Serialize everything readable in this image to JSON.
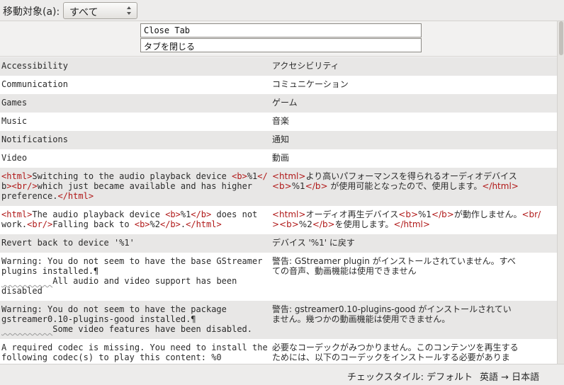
{
  "toolbar": {
    "move_target_label": "移動対象(a):",
    "move_target_value": "すべて"
  },
  "editor": {
    "source_text": "Close Tab",
    "translation_text": "タブを閉じる"
  },
  "rows": [
    {
      "src": "Accessibility",
      "tgt": "アクセシビリティ"
    },
    {
      "src": "Communication",
      "tgt": "コミュニケーション"
    },
    {
      "src": "Games",
      "tgt": "ゲーム"
    },
    {
      "src": "Music",
      "tgt": "音楽"
    },
    {
      "src": "Notifications",
      "tgt": "通知"
    },
    {
      "src": "Video",
      "tgt": "動画"
    },
    {
      "src": "<html>Switching to the audio playback device <b>%1</\nb><br/>which just became available and has higher\npreference.</html>",
      "tgt": "<html>より高いパフォーマンスを得られるオーディオデバイス\n<b>%1</b> が使用可能となったので、使用します。</html>"
    },
    {
      "src": "<html>The audio playback device <b>%1</b> does not\nwork.<br/>Falling back to <b>%2</b>.</html>",
      "tgt": "<html>オーディオ再生デバイス<b>%1</b>が動作しません。<br/\n><b>%2</b>を使用します。</html>"
    },
    {
      "src": "Revert back to device '%1'",
      "tgt": "デバイス '%1' に戻す"
    },
    {
      "src": "Warning: You do not seem to have the base GStreamer\nplugins installed.¶\n          All audio and video support has been\ndisabled",
      "tgt": "警告: GStreamer plugin がインストールされていません。すべ\nての音声、動画機能は使用できません"
    },
    {
      "src": "Warning: You do not seem to have the package\ngstreamer0.10-plugins-good installed.¶\n          Some video features have been disabled.",
      "tgt": "警告: gstreamer0.10-plugins-good がインストールされてい\nません。幾つかの動画機能は使用できません。"
    },
    {
      "src": "A required codec is missing. You need to install the\nfollowing codec(s) to play this content: %0",
      "tgt": "必要なコーデックがみつかりません。このコンテンツを再生する\nためには、以下のコーデックをインストールする必要がありま"
    }
  ],
  "statusbar": {
    "spellcheck_style": "チェックスタイル: デフォルト",
    "language_pair": "英語 → 日本語"
  }
}
